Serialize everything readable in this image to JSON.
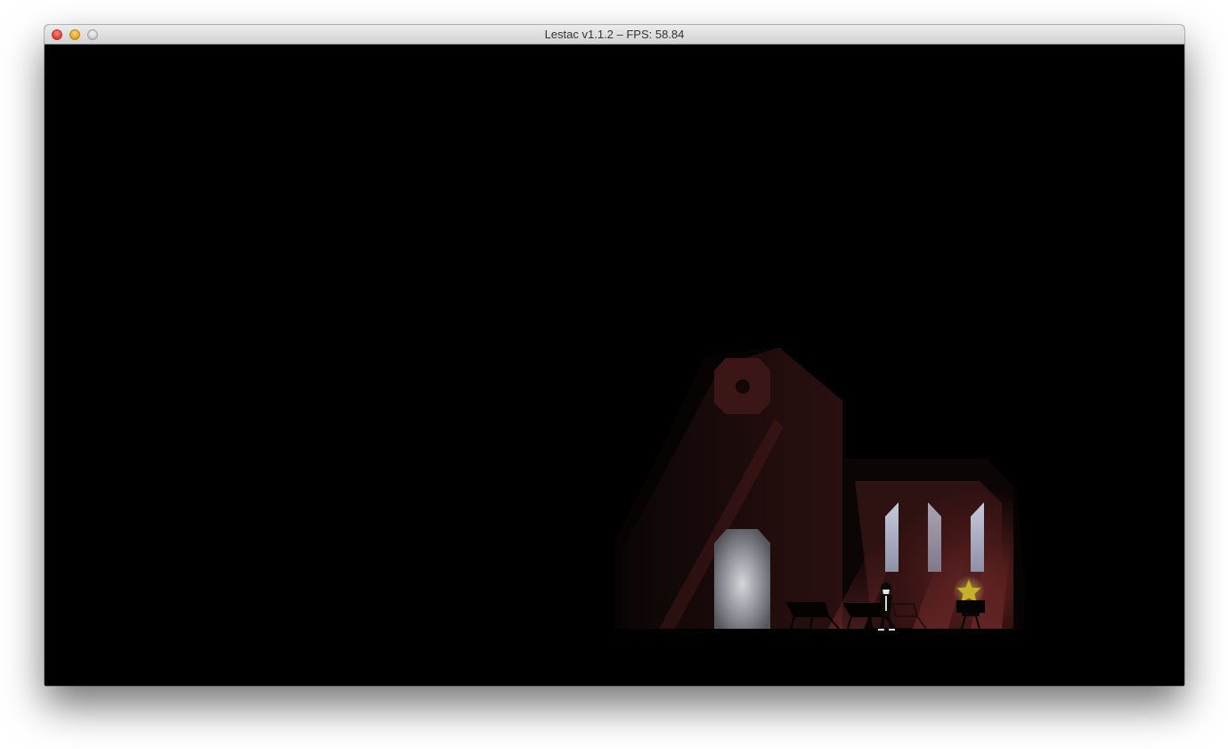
{
  "window": {
    "title": "Lestac v1.1.2 – FPS: 58.84",
    "controls": [
      "close",
      "minimize",
      "zoom"
    ]
  },
  "scene": {
    "description_icons": [
      "church-icon",
      "rose-window-icon",
      "door-icon",
      "bench-icon",
      "player-character-icon",
      "star-icon",
      "pedestal-icon"
    ],
    "colors": {
      "background": "#000000",
      "church_wall": "#3a1616",
      "church_wall_lit": "#6a2a2a",
      "window_light": "#b8bbd0",
      "door_light": "#c9c9cf",
      "star": "#c9b02c"
    },
    "collectible": "star",
    "benches": 3,
    "stained_windows": 3
  }
}
